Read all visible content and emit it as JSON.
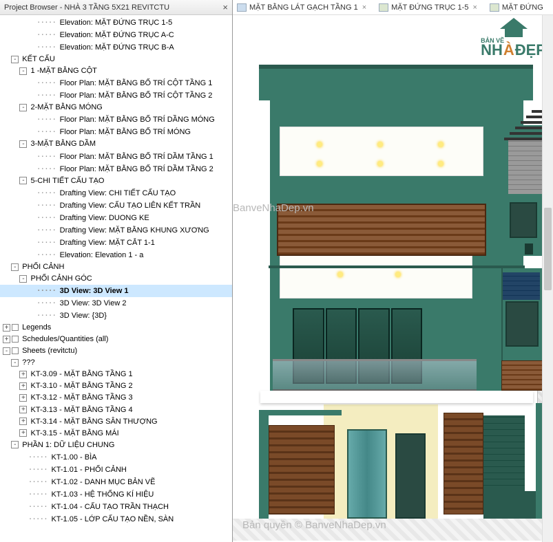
{
  "browser": {
    "title": "Project Browser - NHÀ 3 TẦNG 5X21 REVITCTU",
    "tree": [
      {
        "depth": 4,
        "label": "Elevation: MẶT ĐỨNG TRỤC 1-5"
      },
      {
        "depth": 4,
        "label": "Elevation: MẶT ĐỨNG TRỤC A-C"
      },
      {
        "depth": 4,
        "label": "Elevation: MẶT ĐỨNG TRỤC B-A"
      },
      {
        "depth": 1,
        "expander": "-",
        "label": "KẾT CẤU"
      },
      {
        "depth": 2,
        "expander": "-",
        "label": "1 -MẶT BẰNG CỘT"
      },
      {
        "depth": 4,
        "label": "Floor Plan: MẶT BẰNG BỐ TRÍ CỘT TẦNG 1"
      },
      {
        "depth": 4,
        "label": "Floor Plan: MẶT BẰNG BỐ TRÍ CỘT TẦNG 2"
      },
      {
        "depth": 2,
        "expander": "-",
        "label": "2-MẶT BẰNG MÓNG"
      },
      {
        "depth": 4,
        "label": "Floor Plan: MẶT BẰNG BỐ TRÍ DẦNG MÓNG"
      },
      {
        "depth": 4,
        "label": "Floor Plan: MẶT BẰNG BỐ TRÍ MÓNG"
      },
      {
        "depth": 2,
        "expander": "-",
        "label": "3-MẶT BẰNG DẦM"
      },
      {
        "depth": 4,
        "label": "Floor Plan: MẶT BẰNG BỐ TRÍ DẦM TẦNG 1"
      },
      {
        "depth": 4,
        "label": "Floor Plan: MẶT BẰNG BỐ TRÍ DẦM TẦNG 2"
      },
      {
        "depth": 2,
        "expander": "-",
        "label": "5-CHI TIẾT CẤU TẠO"
      },
      {
        "depth": 4,
        "label": "Drafting View: CHI TIẾT CẤU TẠO"
      },
      {
        "depth": 4,
        "label": "Drafting View: CẤU TẠO LIÊN KẾT TRẦN"
      },
      {
        "depth": 4,
        "label": "Drafting View: DUONG KE"
      },
      {
        "depth": 4,
        "label": "Drafting View: MẶT BẰNG KHUNG XƯƠNG"
      },
      {
        "depth": 4,
        "label": "Drafting View: MẶT CẮT 1-1"
      },
      {
        "depth": 4,
        "label": "Elevation: Elevation 1 - a"
      },
      {
        "depth": 1,
        "expander": "-",
        "label": "PHỐI CẢNH"
      },
      {
        "depth": 2,
        "expander": "-",
        "label": "PHỐI CẢNH GÓC"
      },
      {
        "depth": 4,
        "label": "3D View: 3D View 1",
        "selected": true
      },
      {
        "depth": 4,
        "label": "3D View: 3D View 2"
      },
      {
        "depth": 4,
        "label": "3D View: {3D}"
      },
      {
        "depth": 0,
        "expander": "+",
        "icon": true,
        "label": "Legends"
      },
      {
        "depth": 0,
        "expander": "+",
        "icon": true,
        "label": "Schedules/Quantities (all)"
      },
      {
        "depth": 0,
        "expander": "-",
        "icon": true,
        "label": "Sheets (revitctu)"
      },
      {
        "depth": 1,
        "expander": "-",
        "label": "???"
      },
      {
        "depth": 2,
        "expander": "+",
        "label": "KT-3.09 - MẶT BẰNG TẦNG 1"
      },
      {
        "depth": 2,
        "expander": "+",
        "label": "KT-3.10 - MẶT BẰNG TẦNG 2"
      },
      {
        "depth": 2,
        "expander": "+",
        "label": "KT-3.12 - MẶT BẰNG TẦNG 3"
      },
      {
        "depth": 2,
        "expander": "+",
        "label": "KT-3.13 - MẶT BẰNG TẦNG 4"
      },
      {
        "depth": 2,
        "expander": "+",
        "label": "KT-3.14 - MẶT BẰNG SÂN THƯỢNG"
      },
      {
        "depth": 2,
        "expander": "+",
        "label": "KT-3.15 - MẶT BẰNG MÁI"
      },
      {
        "depth": 1,
        "expander": "-",
        "label": "PHẦN 1: DỮ LIỆU CHUNG"
      },
      {
        "depth": 3,
        "label": "KT-1.00 - BÌA"
      },
      {
        "depth": 3,
        "label": "KT-1.01 - PHỐI CẢNH"
      },
      {
        "depth": 3,
        "label": "KT-1.02 - DANH MỤC BẢN VẼ"
      },
      {
        "depth": 3,
        "label": "KT-1.03 - HỆ THỐNG KÍ HIỆU"
      },
      {
        "depth": 3,
        "label": "KT-1.04 - CẤU TẠO TRẦN THẠCH"
      },
      {
        "depth": 3,
        "label": "KT-1.05 - LỚP CẤU TẠO NỀN, SÀN"
      }
    ]
  },
  "tabs": [
    {
      "label": "MẶT BẰNG LÁT GẠCH TẦNG 1"
    },
    {
      "label": "MẶT ĐỨNG TRỤC 1-5"
    },
    {
      "label": "MẶT ĐỨNG"
    }
  ],
  "watermarks": {
    "center": "BanveNhaDep.vn",
    "bottom": "Bản quyền © BanveNhaDep.vn"
  },
  "logo": {
    "line1": "BẢN VẼ",
    "big1": "NH",
    "big2": "ĐẸP",
    "accent": "À"
  }
}
